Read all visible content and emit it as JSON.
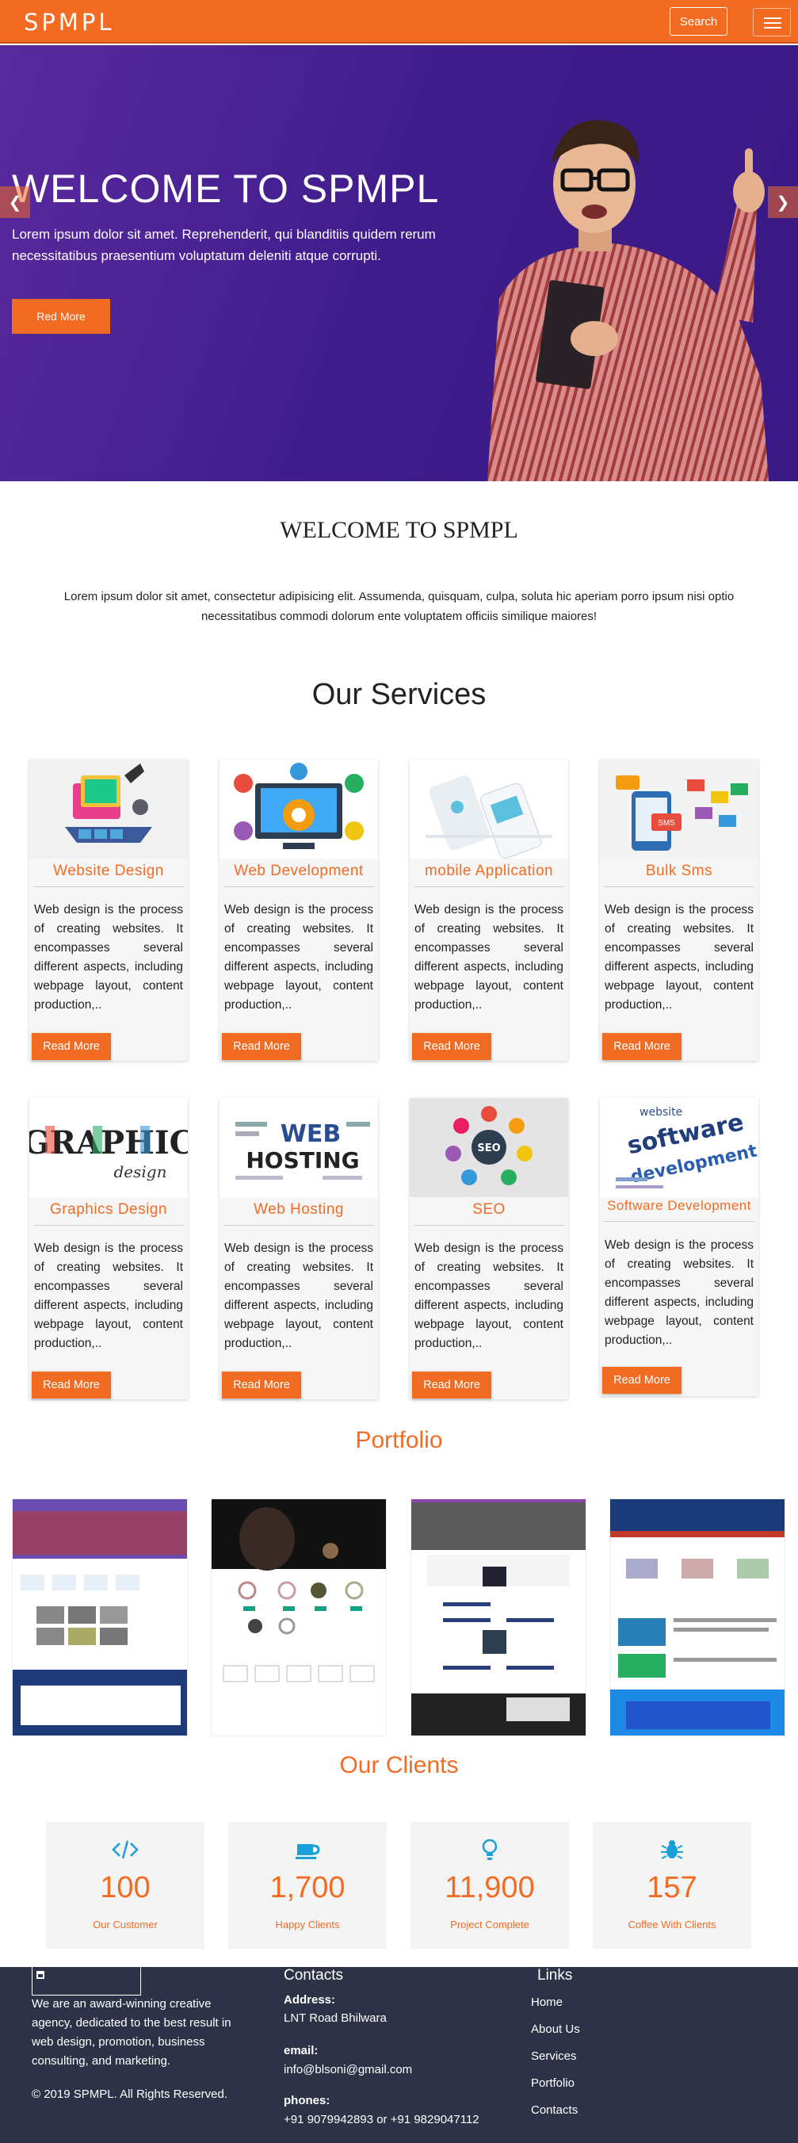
{
  "navbar": {
    "brand": "SPMPL",
    "search_label": "Search",
    "accent": "#f26b23"
  },
  "hero": {
    "title": "WELCOME TO SPMPL",
    "text_line1": "Lorem ipsum dolor sit amet. Reprehenderit, qui blanditiis quidem rerum",
    "text_line2": "necessitatibus praesentium voluptatum deleniti atque corrupti.",
    "button": "Red More",
    "prev_icon": "chevron-left-icon",
    "next_icon": "chevron-right-icon"
  },
  "welcome": {
    "title": "WELCOME TO SPMPL",
    "text": "Lorem ipsum dolor sit amet, consectetur adipisicing elit. Assumenda, quisquam, culpa, soluta hic aperiam porro ipsum nisi optio necessitatibus commodi dolorum ente voluptatem officiis similique maiores!"
  },
  "services": {
    "title": "Our Services",
    "items": [
      {
        "title": "Website Design",
        "desc": "Web design is the process of creating websites. It encompasses several different aspects, including webpage layout, content production,..",
        "button": "Read More"
      },
      {
        "title": "Web Development",
        "desc": "Web design is the process of creating websites. It encompasses several different aspects, including webpage layout, content production,..",
        "button": "Read More"
      },
      {
        "title": "mobile Application",
        "desc": "Web design is the process of creating websites. It encompasses several different aspects, including webpage layout, content production,..",
        "button": "Read More"
      },
      {
        "title": "Bulk Sms",
        "desc": "Web design is the process of creating websites. It encompasses several different aspects, including webpage layout, content production,..",
        "button": "Read More"
      },
      {
        "title": "Graphics Design",
        "desc": "Web design is the process of creating websites. It encompasses several different aspects, including webpage layout, content production,..",
        "button": "Read More"
      },
      {
        "title": "Web Hosting",
        "desc": "Web design is the process of creating websites. It encompasses several different aspects, including webpage layout, content production,..",
        "button": "Read More"
      },
      {
        "title": "SEO",
        "desc": "Web design is the process of creating websites. It encompasses several different aspects, including webpage layout, content production,..",
        "button": "Read More"
      },
      {
        "title": "Software Development",
        "desc": "Web design is the process of creating websites. It encompasses several different aspects, including webpage layout, content production,..",
        "button": "Read More"
      }
    ],
    "image_texts": {
      "graphic": "GRAPHIC",
      "graphic_sub": "design",
      "hosting_web": "WEB",
      "hosting": "HOSTING",
      "seo": "SEO",
      "sms": "SMS",
      "software": "software",
      "development": "development",
      "website": "website"
    }
  },
  "portfolio": {
    "title": "Portfolio"
  },
  "clients": {
    "title": "Our Clients",
    "stats": [
      {
        "icon": "code-icon",
        "value": "100",
        "label": "Our Customer"
      },
      {
        "icon": "coffee-icon",
        "value": "1,700",
        "label": "Happy Clients"
      },
      {
        "icon": "lightbulb-icon",
        "value": "11,900",
        "label": "Project Complete"
      },
      {
        "icon": "bug-icon",
        "value": "157",
        "label": "Coffee With Clients"
      }
    ]
  },
  "footer": {
    "about": "We are an award-winning creative agency, dedicated to the best result in web design, promotion, business consulting, and marketing.",
    "copyright": "©  2019 SPMPL. All Rights Reserved.",
    "contacts_title": "Contacts",
    "address_label": "Address:",
    "address": "LNT Road Bhilwara",
    "email_label": "email:",
    "email": "info@blsoni@gmail.com",
    "phones_label": "phones:",
    "phones": "+91 9079942893 or +91 9829047112",
    "links_title": "Links",
    "links": [
      "Home",
      "About Us",
      "Services",
      "Portfolio",
      "Contacts"
    ]
  }
}
